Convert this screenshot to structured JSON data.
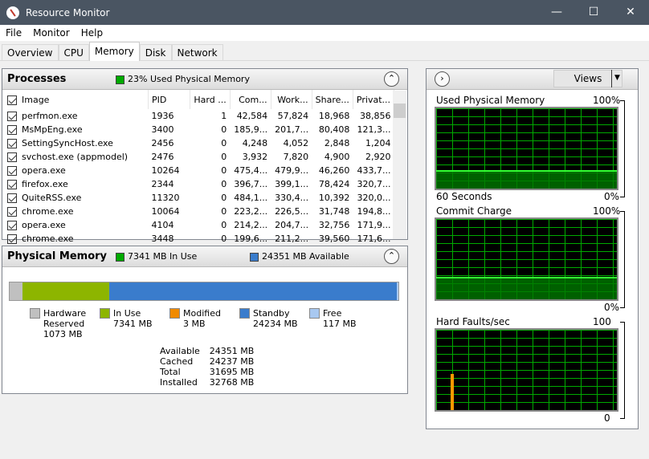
{
  "window": {
    "title": "Resource Monitor",
    "minimize": "—",
    "maximize": "☐",
    "close": "✕"
  },
  "menu": [
    "File",
    "Monitor",
    "Help"
  ],
  "tabs": [
    "Overview",
    "CPU",
    "Memory",
    "Disk",
    "Network"
  ],
  "active_tab": "Memory",
  "processes": {
    "title": "Processes",
    "status": "23% Used Physical Memory",
    "columns": [
      "Image",
      "PID",
      "Hard ...",
      "Com...",
      "Work...",
      "Share...",
      "Privat..."
    ],
    "rows": [
      [
        "perfmon.exe",
        "1936",
        "1",
        "42,584",
        "57,824",
        "18,968",
        "38,856"
      ],
      [
        "MsMpEng.exe",
        "3400",
        "0",
        "185,9...",
        "201,7...",
        "80,408",
        "121,3..."
      ],
      [
        "SettingSyncHost.exe",
        "2456",
        "0",
        "4,248",
        "4,052",
        "2,848",
        "1,204"
      ],
      [
        "svchost.exe (appmodel)",
        "2476",
        "0",
        "3,932",
        "7,820",
        "4,900",
        "2,920"
      ],
      [
        "opera.exe",
        "10264",
        "0",
        "475,4...",
        "479,9...",
        "46,260",
        "433,7..."
      ],
      [
        "firefox.exe",
        "2344",
        "0",
        "396,7...",
        "399,1...",
        "78,424",
        "320,7..."
      ],
      [
        "QuiteRSS.exe",
        "11320",
        "0",
        "484,1...",
        "330,4...",
        "10,392",
        "320,0..."
      ],
      [
        "chrome.exe",
        "10064",
        "0",
        "223,2...",
        "226,5...",
        "31,748",
        "194,8..."
      ],
      [
        "opera.exe",
        "4104",
        "0",
        "214,2...",
        "204,7...",
        "32,756",
        "171,9..."
      ],
      [
        "chrome.exe",
        "3448",
        "0",
        "199,6...",
        "211,2...",
        "39,560",
        "171,6..."
      ]
    ]
  },
  "physical_memory": {
    "title": "Physical Memory",
    "in_use": "7341 MB In Use",
    "available": "24351 MB Available",
    "bar_mb": {
      "hardware": 1073,
      "in_use": 7341,
      "modified": 3,
      "standby": 24234,
      "free": 117
    },
    "legend": [
      {
        "l1": "Hardware",
        "l2": "Reserved",
        "l3": "1073 MB",
        "color": "#c0c0c0"
      },
      {
        "l1": "In Use",
        "l2": "7341 MB",
        "l3": "",
        "color": "#8db500"
      },
      {
        "l1": "Modified",
        "l2": "3 MB",
        "l3": "",
        "color": "#f08a00"
      },
      {
        "l1": "Standby",
        "l2": "24234 MB",
        "l3": "",
        "color": "#3a7ccc"
      },
      {
        "l1": "Free",
        "l2": "117 MB",
        "l3": "",
        "color": "#a8c8f0"
      }
    ],
    "stats": [
      [
        "Available",
        "24351 MB"
      ],
      [
        "Cached",
        "24237 MB"
      ],
      [
        "Total",
        "31695 MB"
      ],
      [
        "Installed",
        "32768 MB"
      ]
    ]
  },
  "right": {
    "views": "Views",
    "graphs": [
      {
        "title": "Used Physical Memory",
        "max": "100%",
        "footer": "60 Seconds",
        "min": "0%",
        "level": 0.23
      },
      {
        "title": "Commit Charge",
        "max": "100%",
        "footer": "",
        "min": "0%",
        "level": 0.28
      },
      {
        "title": "Hard Faults/sec",
        "max": "100",
        "footer": "",
        "min": "0",
        "level": 0.0
      }
    ]
  }
}
